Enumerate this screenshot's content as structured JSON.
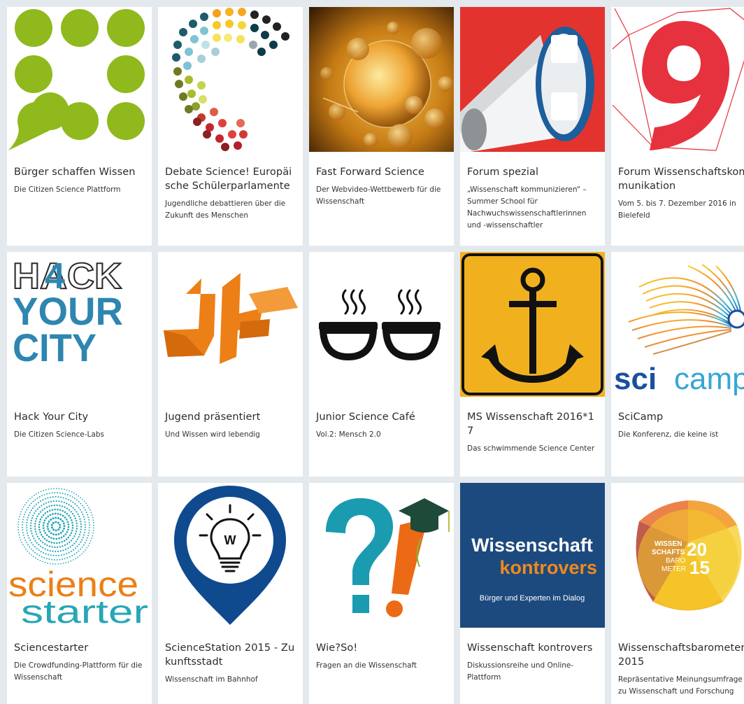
{
  "colors": {
    "page_bg": "#e3e9ed",
    "card_bg": "#ffffff",
    "green": "#8fb91c",
    "megaphone_red": "#e3332f",
    "forum_red": "#e6323e",
    "anchor_yellow": "#f1b11f",
    "hack_blue": "#2e86b0",
    "jugend_orange": "#ec7f16",
    "station_blue": "#0f4a8f",
    "kontrovers_blue": "#1d4a7e",
    "kontrovers_orange": "#f08a1e",
    "starter_teal": "#27a6b6"
  },
  "cards": [
    {
      "title": "Bürger schaffen Wissen",
      "desc": "Die Citizen Science Plattform",
      "icon": "speech-dots-logo"
    },
    {
      "title": "Debate Science! Europäische Schülerparlamente",
      "desc": "Jugendliche debattieren über die Zukunft des Menschen",
      "icon": "dots-arc-logo"
    },
    {
      "title": "Fast Forward Science",
      "desc": "Der Webvideo-Wettbewerb für die Wissenschaft",
      "icon": "cells-photo"
    },
    {
      "title": "Forum spezial",
      "desc": "„Wissenschaft kommunizieren“ – Summer School für Nachwuchswissenschaftlerinnen und -wissenschaftler",
      "icon": "megaphone-icon"
    },
    {
      "title": "Forum Wissenschaftskommunikation",
      "desc": "Vom 5. bis 7. Dezember 2016 in Bielefeld",
      "icon": "number-nine-logo"
    },
    {
      "title": "Hack Your City",
      "desc": "Die Citizen Science-Labs",
      "icon": "hack-your-city-logo",
      "logo": {
        "line1": "HACK",
        "line2": "YOUR",
        "line3": "CITY",
        "digit": "4"
      }
    },
    {
      "title": "Jugend präsentiert",
      "desc": "Und Wissen wird lebendig",
      "icon": "jugend-praesentiert-logo"
    },
    {
      "title": "Junior Science Café",
      "desc": "Vol.2: Mensch 2.0",
      "icon": "coffee-cups-icon"
    },
    {
      "title": "MS Wissenschaft 2016*17",
      "desc": "Das schwimmende Science Center",
      "icon": "anchor-icon"
    },
    {
      "title": "SciCamp",
      "desc": "Die Konferenz, die keine ist",
      "icon": "scicamp-logo",
      "logo": {
        "part1": "sci",
        "part2": "camp"
      }
    },
    {
      "title": "Sciencestarter",
      "desc": "Die Crowdfunding-Plattform für die Wissenschaft",
      "icon": "sciencestarter-logo",
      "logo": {
        "line1": "science",
        "line2": "starter"
      }
    },
    {
      "title": "ScienceStation 2015 - Zukunftsstadt",
      "desc": "Wissenschaft im Bahnhof",
      "icon": "lightbulb-pin-icon",
      "logo": {
        "letter": "W"
      }
    },
    {
      "title": "Wie?So!",
      "desc": "Fragen an die Wissenschaft",
      "icon": "question-exclamation-icon"
    },
    {
      "title": "Wissenschaft kontrovers",
      "desc": "Diskussionsreihe und Online-Plattform",
      "icon": "wissenschaft-kontrovers-logo",
      "logo": {
        "line1": "Wissenschaft",
        "line2": "kontrovers",
        "line3": "Bürger und Experten im Dialog"
      }
    },
    {
      "title": "Wissenschaftsbarometer 2015",
      "desc": "Repräsentative Meinungsumfrage zu Wissenschaft und Forschung",
      "icon": "wissenschaftsbarometer-logo",
      "logo": {
        "line1": "WISSEN",
        "line2": "SCHAFTS",
        "line3": "BARO",
        "line4": "METER",
        "year_top": "20",
        "year_bottom": "15"
      }
    }
  ]
}
